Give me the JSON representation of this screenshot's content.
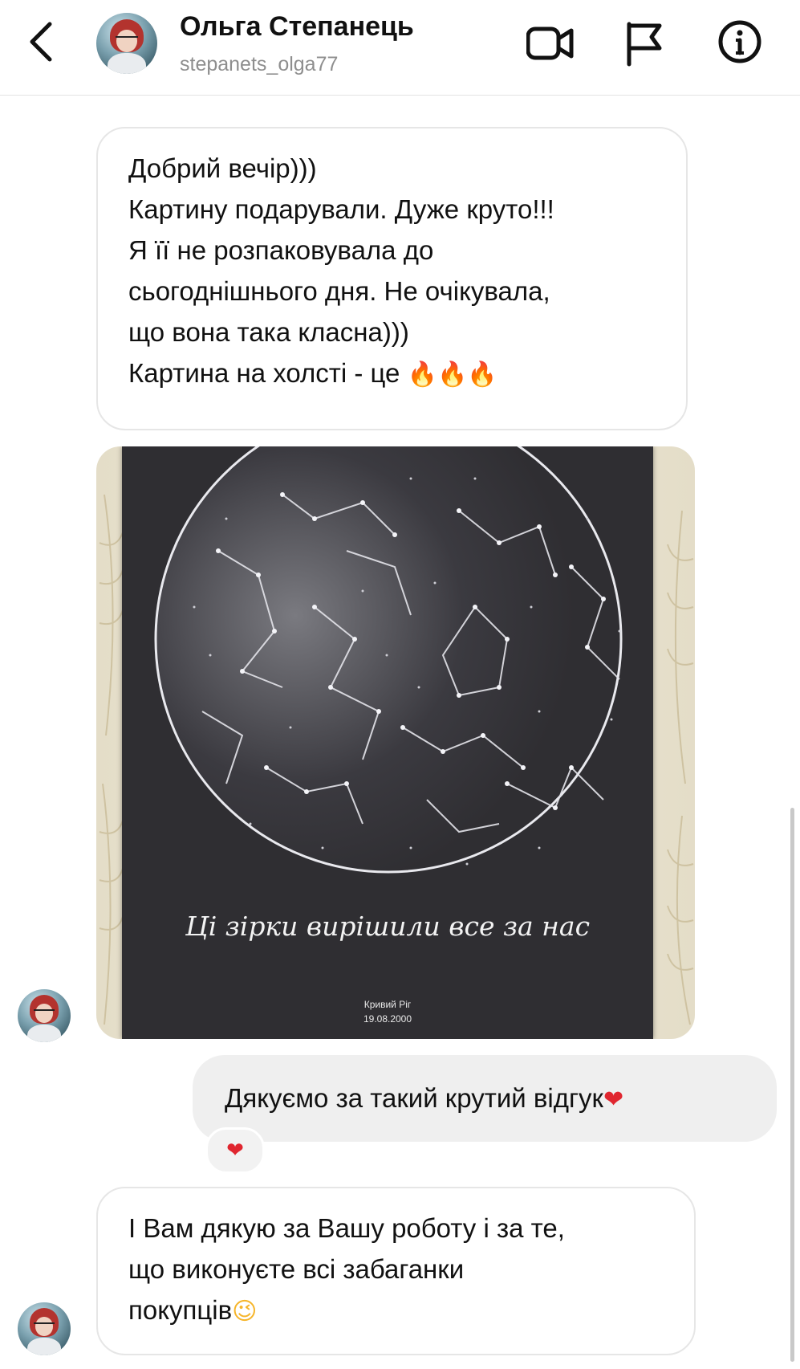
{
  "header": {
    "contact_name": "Ольга Степанець",
    "contact_handle": "stepanets_olga77",
    "icons": [
      "chevron-left-icon",
      "video-call-icon",
      "flag-icon",
      "info-icon"
    ]
  },
  "messages": {
    "incoming_1": {
      "lines": [
        "Добрий вечір)))",
        "Картину подарували. Дуже круто!!!",
        "Я її не розпаковувала до",
        "сьогоднішнього дня. Не очікувала,",
        "що вона така класна)))",
        "Картина на холсті - це"
      ],
      "emoji": "🔥🔥🔥"
    },
    "photo": {
      "caption": "Ці зірки вирішили все за нас",
      "city": "Кривий Ріг",
      "date": "19.08.2000"
    },
    "outgoing_1": {
      "text": "Дякуємо за такий крутий відгук",
      "emoji": "❤",
      "reaction": "❤"
    },
    "incoming_2": {
      "lines": [
        "І Вам дякую за Вашу роботу і за те,",
        "що виконуєте всі забаганки",
        "покупців"
      ],
      "emoji": "😉"
    }
  },
  "colors": {
    "fire": "#f0771e",
    "heart": "#e0262f",
    "wink": "#f6b52a",
    "bubble_out": "#efefef",
    "border": "#e6e6e6"
  }
}
